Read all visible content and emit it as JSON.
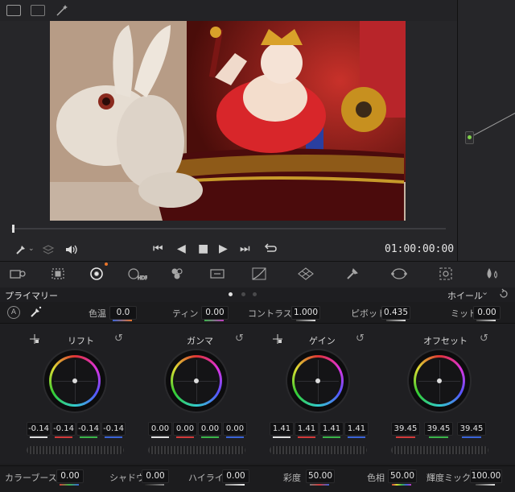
{
  "viewer": {
    "timecode": "01:00:00:00"
  },
  "header": {
    "section_title": "プライマリー",
    "mode_select": "ホイール",
    "mode_chevron": "⌄"
  },
  "adjust": {
    "temperature_label": "色温",
    "temperature_value": "0.0",
    "tint_label": "ティント",
    "tint_value": "0.00",
    "contrast_label": "コントラスト",
    "contrast_value": "1.000",
    "pivot_label": "ピボット",
    "pivot_value": "0.435",
    "midtone_label": "ミッド",
    "midtone_value": "0.00"
  },
  "wheels": [
    {
      "title": "リフト",
      "values": [
        "-0.14",
        "-0.14",
        "-0.14",
        "-0.14"
      ]
    },
    {
      "title": "ガンマ",
      "values": [
        "0.00",
        "0.00",
        "0.00",
        "0.00"
      ]
    },
    {
      "title": "ゲイン",
      "values": [
        "1.41",
        "1.41",
        "1.41",
        "1.41"
      ]
    },
    {
      "title": "オフセット",
      "values": [
        "39.45",
        "39.45",
        "39.45"
      ]
    }
  ],
  "bottom": {
    "color_boost_label": "カラーブースト",
    "color_boost_value": "0.00",
    "shadow_label": "シャドウ",
    "shadow_value": "0.00",
    "highlight_label": "ハイライト",
    "highlight_value": "0.00",
    "saturation_label": "彩度",
    "saturation_value": "50.00",
    "hue_label": "色相",
    "hue_value": "50.00",
    "lum_mix_label": "輝度ミックス",
    "lum_mix_value": "100.00"
  },
  "colors": {
    "red_channel": "#d23a3a",
    "green_channel": "#3ab54a",
    "blue_channel": "#3a64d8",
    "accent_orange": "#e8742a"
  }
}
